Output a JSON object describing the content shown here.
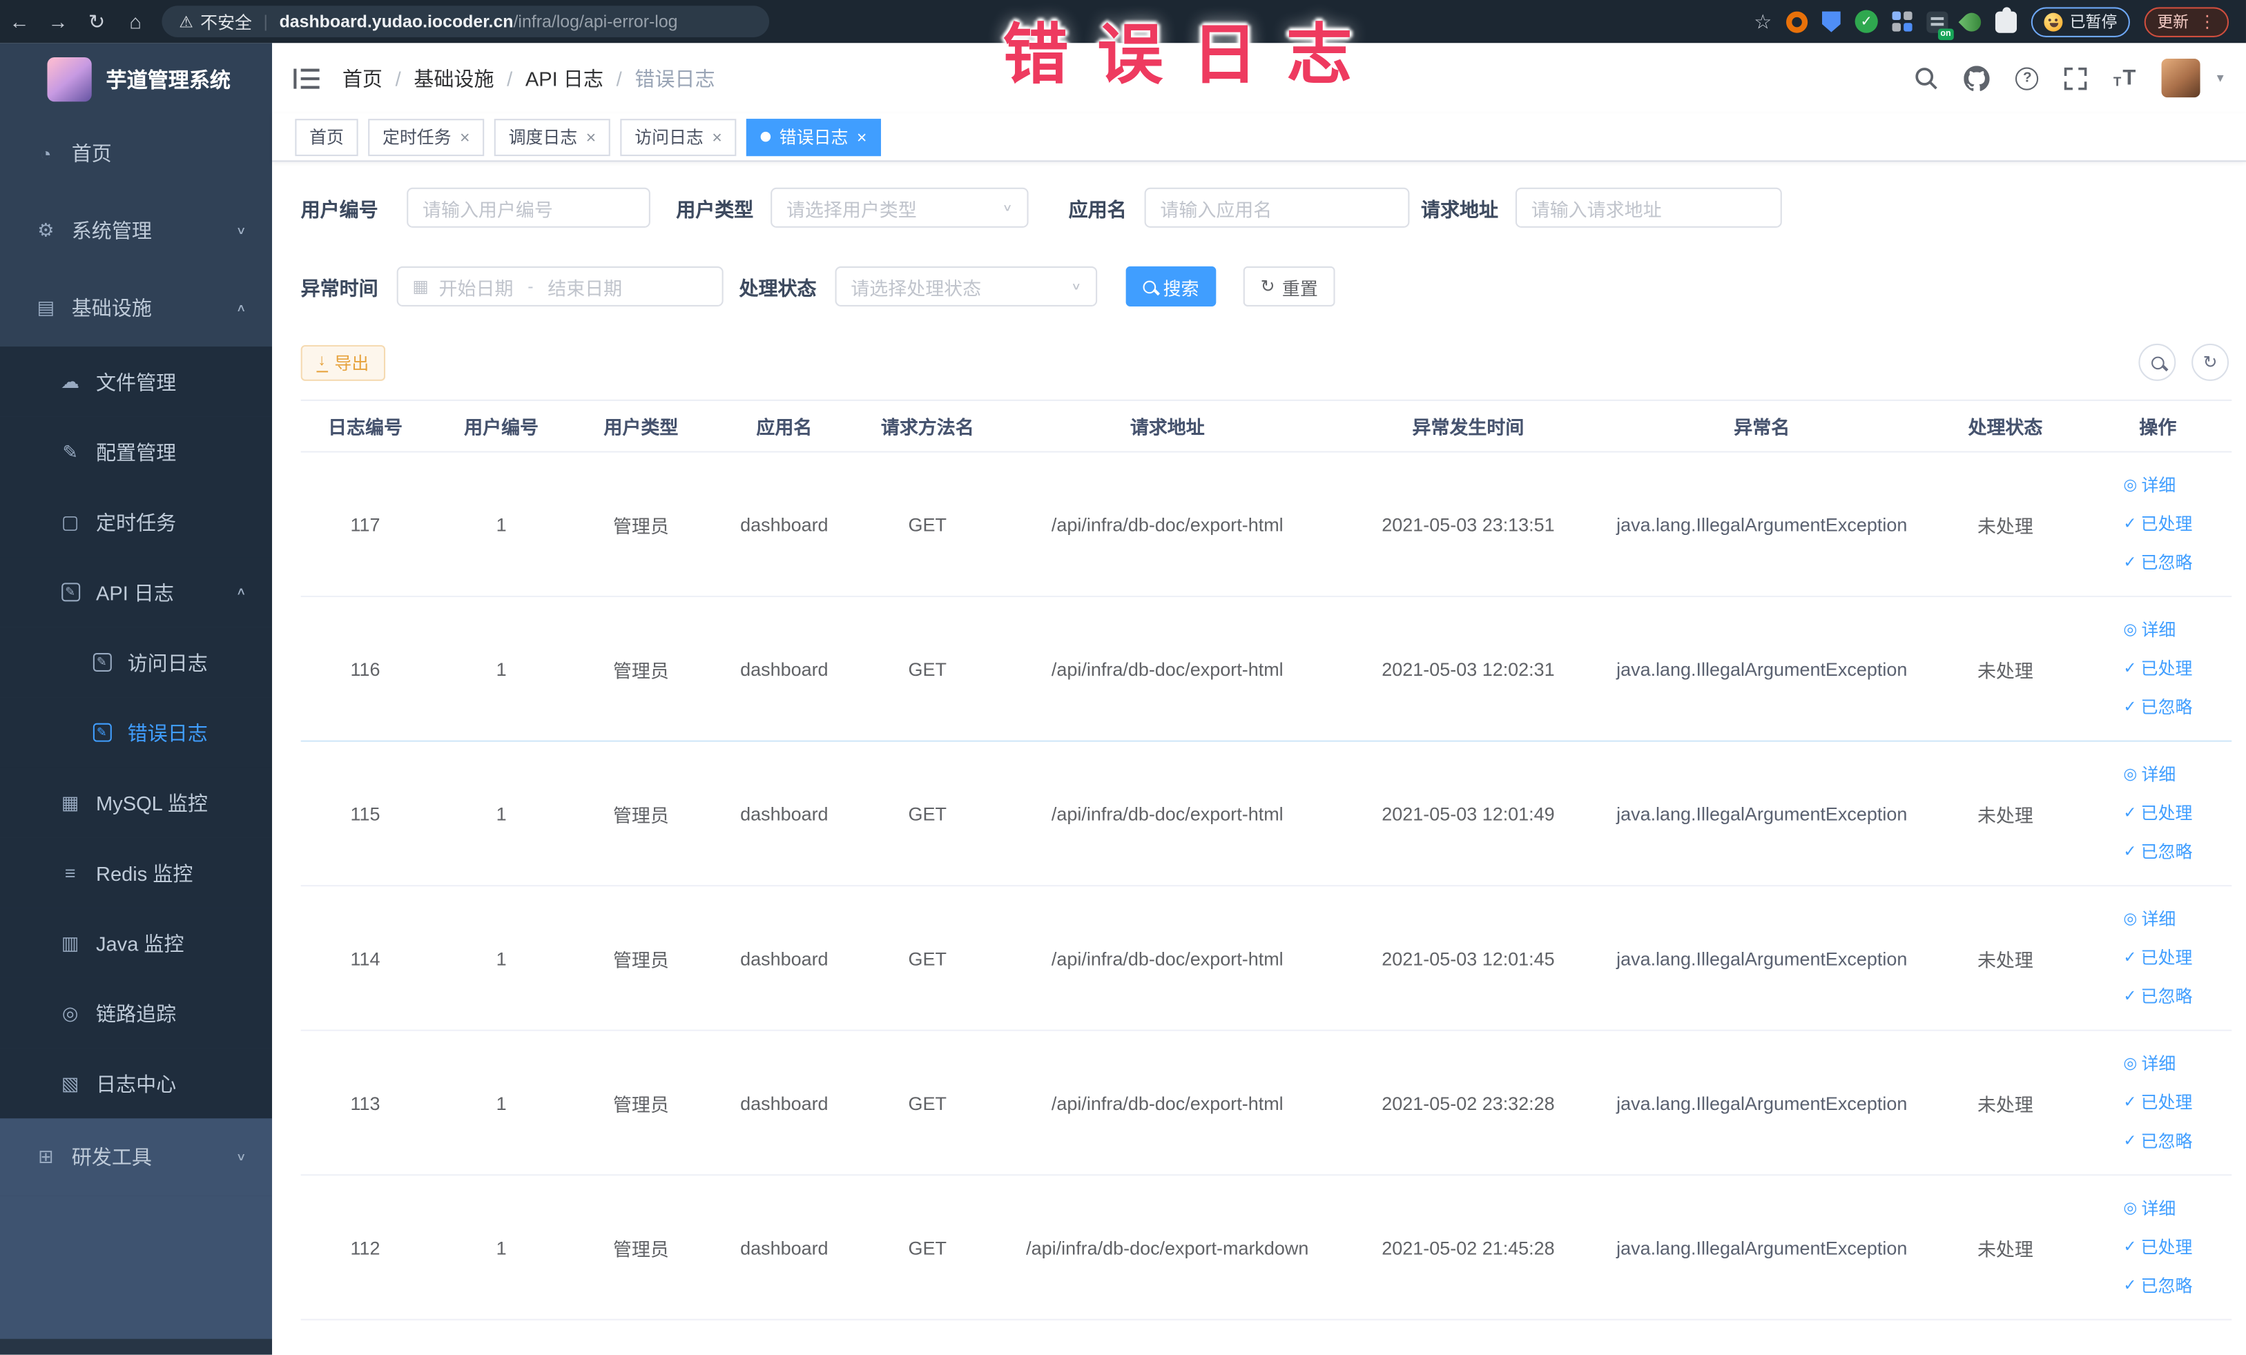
{
  "browser": {
    "security_label": "不安全",
    "url_host": "dashboard.yudao.iocoder.cn",
    "url_path": "/infra/log/api-error-log",
    "paused_label": "已暂停",
    "update_label": "更新",
    "on_badge": "on"
  },
  "icons": {
    "back": "←",
    "forward": "→",
    "reload": "↻",
    "home": "⌂",
    "warning": "⚠",
    "star": "☆",
    "kebab": "⋮",
    "caret": "▼",
    "close": "×",
    "check": "✓",
    "eye": "◎",
    "download": "↓",
    "refresh": "↻",
    "question": "?",
    "text_size": "T",
    "select_caret": "∨",
    "calendar": "▦",
    "up": "∧",
    "down": "∨"
  },
  "annotation": {
    "text": "错误日志",
    "color": "#ee3a5f"
  },
  "sidebar": {
    "logo_title": "芋道管理系统",
    "icon_glyphs": {
      "dashboard": "◔",
      "gear": "⚙",
      "monitor": "▤",
      "cloud": "☁",
      "edit": "✎",
      "schedule": "▢",
      "log-box": "✎",
      "mysql": "▦",
      "redis": "≡",
      "java": "▥",
      "trace": "◎",
      "log-center": "▧",
      "tools": "⊞"
    },
    "items": [
      {
        "label": "首页",
        "icon": "dashboard",
        "level": 1
      },
      {
        "label": "系统管理",
        "icon": "gear",
        "level": 1,
        "arrow": "down"
      },
      {
        "label": "基础设施",
        "icon": "monitor",
        "level": 1,
        "arrow": "up"
      },
      {
        "label": "文件管理",
        "icon": "cloud",
        "level": 2
      },
      {
        "label": "配置管理",
        "icon": "edit",
        "level": 2
      },
      {
        "label": "定时任务",
        "icon": "schedule",
        "level": 2
      },
      {
        "label": "API 日志",
        "icon": "log-box",
        "level": 2,
        "arrow": "up"
      },
      {
        "label": "访问日志",
        "icon": "log-box",
        "level": 3
      },
      {
        "label": "错误日志",
        "icon": "log-box",
        "level": 3,
        "active": true
      },
      {
        "label": "MySQL 监控",
        "icon": "mysql",
        "level": 2
      },
      {
        "label": "Redis 监控",
        "icon": "redis",
        "level": 2
      },
      {
        "label": "Java 监控",
        "icon": "java",
        "level": 2
      },
      {
        "label": "链路追踪",
        "icon": "trace",
        "level": 2
      },
      {
        "label": "日志中心",
        "icon": "log-center",
        "level": 2
      },
      {
        "label": "研发工具",
        "icon": "tools",
        "level": 1,
        "arrow": "down",
        "section": "light"
      }
    ]
  },
  "header": {
    "breadcrumb": [
      "首页",
      "基础设施",
      "API 日志",
      "错误日志"
    ],
    "separator": "/"
  },
  "tabs": [
    {
      "label": "首页",
      "closable": false,
      "active": false
    },
    {
      "label": "定时任务",
      "closable": true,
      "active": false
    },
    {
      "label": "调度日志",
      "closable": true,
      "active": false
    },
    {
      "label": "访问日志",
      "closable": true,
      "active": false
    },
    {
      "label": "错误日志",
      "closable": true,
      "active": true
    }
  ],
  "filters": {
    "user_id": {
      "label": "用户编号",
      "placeholder": "请输入用户编号"
    },
    "user_type": {
      "label": "用户类型",
      "placeholder": "请选择用户类型"
    },
    "app_name": {
      "label": "应用名",
      "placeholder": "请输入应用名"
    },
    "request_url": {
      "label": "请求地址",
      "placeholder": "请输入请求地址"
    },
    "time": {
      "label": "异常时间",
      "start_placeholder": "开始日期",
      "separator": "-",
      "end_placeholder": "结束日期"
    },
    "status": {
      "label": "处理状态",
      "placeholder": "请选择处理状态"
    },
    "search_label": "搜索",
    "reset_label": "重置"
  },
  "toolbar": {
    "export_label": "导出"
  },
  "table": {
    "columns": [
      "日志编号",
      "用户编号",
      "用户类型",
      "应用名",
      "请求方法名",
      "请求地址",
      "异常发生时间",
      "异常名",
      "处理状态",
      "操作"
    ],
    "rows": [
      {
        "id": "117",
        "user_id": "1",
        "user_type": "管理员",
        "app": "dashboard",
        "method": "GET",
        "url": "/api/infra/db-doc/export-html",
        "time": "2021-05-03 23:13:51",
        "exception": "java.lang.IllegalArgumentException",
        "status": "未处理"
      },
      {
        "id": "116",
        "user_id": "1",
        "user_type": "管理员",
        "app": "dashboard",
        "method": "GET",
        "url": "/api/infra/db-doc/export-html",
        "time": "2021-05-03 12:02:31",
        "exception": "java.lang.IllegalArgumentException",
        "status": "未处理"
      },
      {
        "id": "115",
        "user_id": "1",
        "user_type": "管理员",
        "app": "dashboard",
        "method": "GET",
        "url": "/api/infra/db-doc/export-html",
        "time": "2021-05-03 12:01:49",
        "exception": "java.lang.IllegalArgumentException",
        "status": "未处理"
      },
      {
        "id": "114",
        "user_id": "1",
        "user_type": "管理员",
        "app": "dashboard",
        "method": "GET",
        "url": "/api/infra/db-doc/export-html",
        "time": "2021-05-03 12:01:45",
        "exception": "java.lang.IllegalArgumentException",
        "status": "未处理"
      },
      {
        "id": "113",
        "user_id": "1",
        "user_type": "管理员",
        "app": "dashboard",
        "method": "GET",
        "url": "/api/infra/db-doc/export-html",
        "time": "2021-05-02 23:32:28",
        "exception": "java.lang.IllegalArgumentException",
        "status": "未处理"
      },
      {
        "id": "112",
        "user_id": "1",
        "user_type": "管理员",
        "app": "dashboard",
        "method": "GET",
        "url": "/api/infra/db-doc/export-markdown",
        "time": "2021-05-02 21:45:28",
        "exception": "java.lang.IllegalArgumentException",
        "status": "未处理"
      }
    ],
    "row_actions": [
      {
        "label": "详细",
        "icon": "eye"
      },
      {
        "label": "已处理",
        "icon": "check"
      },
      {
        "label": "已忽略",
        "icon": "check"
      }
    ]
  }
}
